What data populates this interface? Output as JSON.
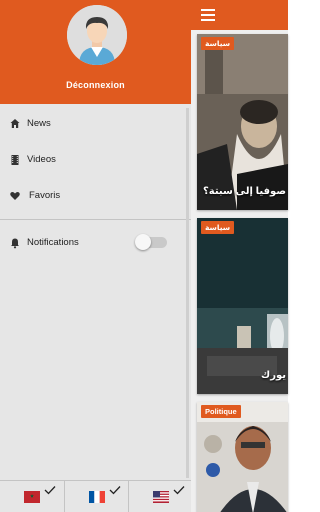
{
  "drawer": {
    "logout_label": "Déconnexion",
    "items": [
      {
        "label": "News",
        "icon": "home-icon"
      },
      {
        "label": "Videos",
        "icon": "film-icon"
      },
      {
        "label": "Favoris",
        "icon": "heart-icon"
      }
    ],
    "notifications": {
      "label": "Notifications",
      "icon": "bell-icon",
      "enabled": false
    },
    "languages": [
      {
        "flag": "morocco-flag",
        "checked": true
      },
      {
        "flag": "france-flag",
        "checked": true
      },
      {
        "flag": "usa-flag",
        "checked": true
      }
    ]
  },
  "main": {
    "menu_icon": "hamburger-icon",
    "cards": [
      {
        "tag": "سياسة",
        "title": "صوفيا إلى سبتة؟"
      },
      {
        "tag": "سياسة",
        "title": "يورك"
      },
      {
        "tag": "Politique",
        "title": ""
      }
    ]
  },
  "colors": {
    "accent": "#e05a1f",
    "drawer_bg": "#e6e6e6",
    "divider": "#c4c4c4"
  }
}
